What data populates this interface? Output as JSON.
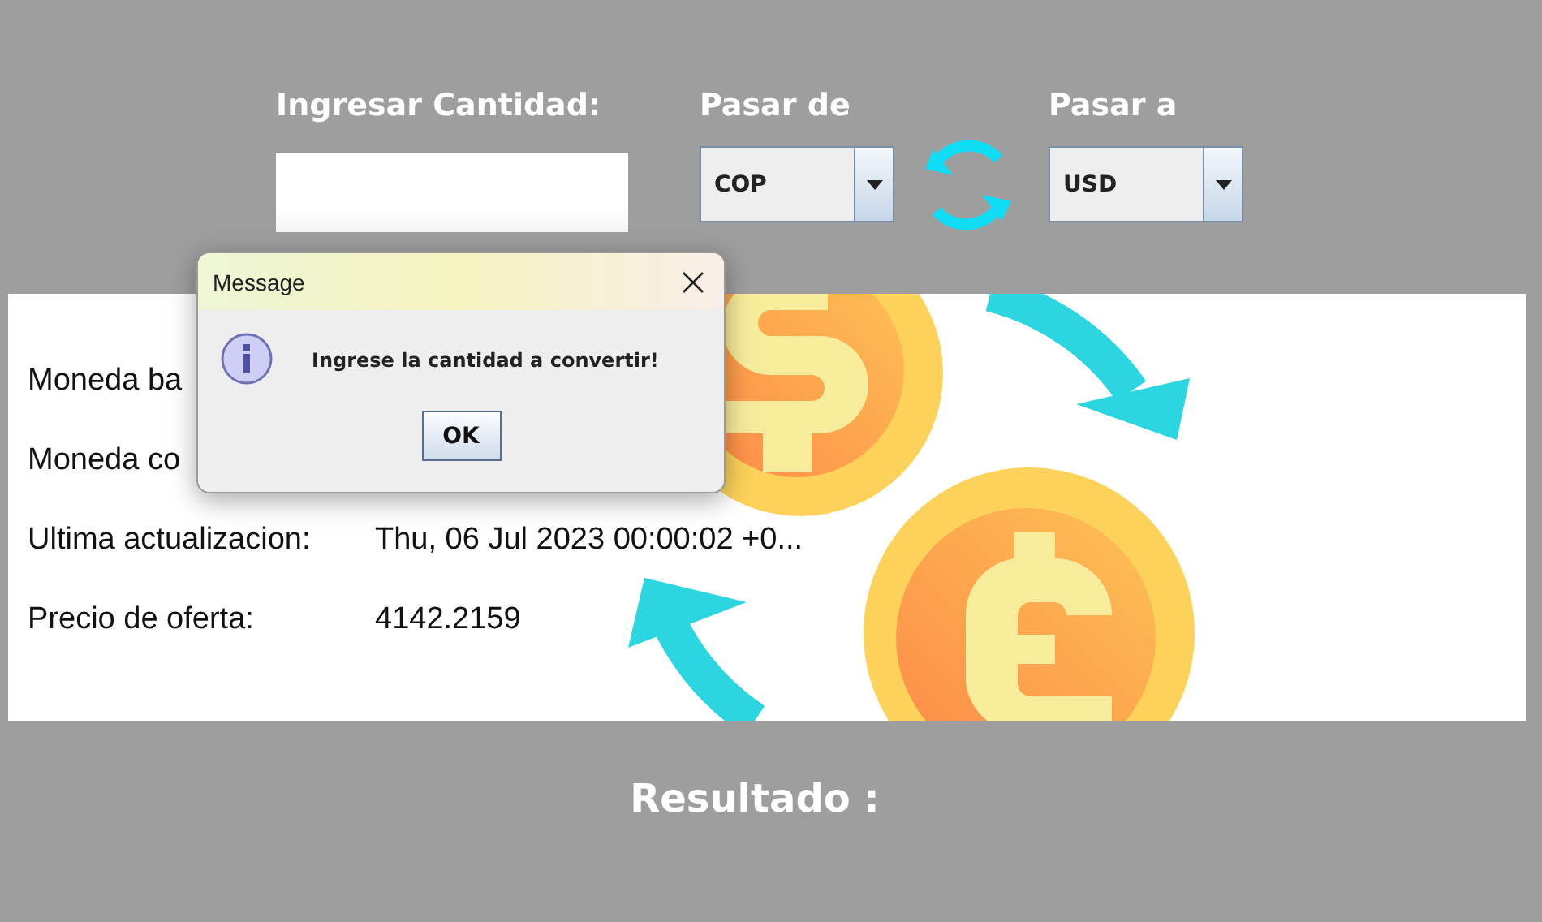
{
  "form": {
    "amount": {
      "label": "Ingresar Cantidad:"
    },
    "from": {
      "label": "Pasar de",
      "value": "COP"
    },
    "to": {
      "label": "Pasar a",
      "value": "USD"
    }
  },
  "info_rows": [
    {
      "label": "Moneda ba"
    },
    {
      "label": "Moneda co"
    },
    {
      "label": "Ultima actualizacion:",
      "value": "Thu, 06 Jul 2023 00:00:02 +0..."
    },
    {
      "label": "Precio de oferta:",
      "value": "4142.2159"
    }
  ],
  "result": {
    "label": "Resultado :"
  },
  "dialog": {
    "title": "Message",
    "kind": "info",
    "message": "Ingrese la cantidad a convertir!",
    "buttons": [
      "OK"
    ]
  }
}
